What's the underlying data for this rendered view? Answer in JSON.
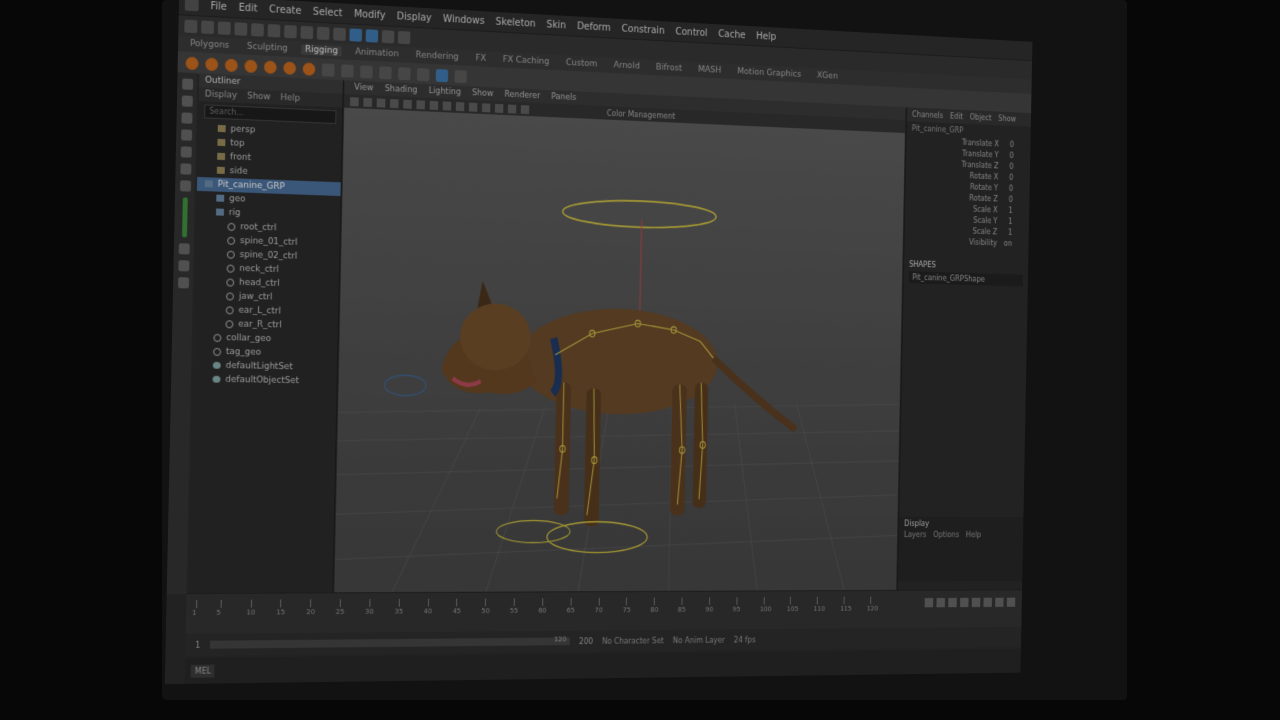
{
  "menubar": {
    "items": [
      "File",
      "Edit",
      "Create",
      "Select",
      "Modify",
      "Display",
      "Windows",
      "Skeleton",
      "Skin",
      "Deform",
      "Constrain",
      "Control",
      "Cache",
      "Help"
    ]
  },
  "shelf": {
    "tabs": [
      "Polygons",
      "Sculpting",
      "Rigging",
      "Animation",
      "Rendering",
      "FX",
      "FX Caching",
      "Custom",
      "Arnold",
      "Bifrost",
      "MASH",
      "Motion Graphics",
      "XGen"
    ],
    "active_tab": "Rigging"
  },
  "outliner": {
    "title": "Outliner",
    "menu": [
      "Display",
      "Show",
      "Help"
    ],
    "search_placeholder": "Search...",
    "rows": [
      {
        "label": "persp",
        "icon": "camera-icon",
        "indent": 1,
        "selected": false
      },
      {
        "label": "top",
        "icon": "camera-icon",
        "indent": 1,
        "selected": false
      },
      {
        "label": "front",
        "icon": "camera-icon",
        "indent": 1,
        "selected": false
      },
      {
        "label": "side",
        "icon": "camera-icon",
        "indent": 1,
        "selected": false
      },
      {
        "label": "Pit_canine_GRP",
        "icon": "group-icon",
        "indent": 0,
        "selected": true
      },
      {
        "label": "geo",
        "icon": "group-icon",
        "indent": 1,
        "selected": false
      },
      {
        "label": "rig",
        "icon": "group-icon",
        "indent": 1,
        "selected": false
      },
      {
        "label": "root_ctrl",
        "icon": "control-icon",
        "indent": 2,
        "selected": false
      },
      {
        "label": "spine_01_ctrl",
        "icon": "control-icon",
        "indent": 2,
        "selected": false
      },
      {
        "label": "spine_02_ctrl",
        "icon": "control-icon",
        "indent": 2,
        "selected": false
      },
      {
        "label": "neck_ctrl",
        "icon": "control-icon",
        "indent": 2,
        "selected": false
      },
      {
        "label": "head_ctrl",
        "icon": "control-icon",
        "indent": 2,
        "selected": false
      },
      {
        "label": "jaw_ctrl",
        "icon": "control-icon",
        "indent": 2,
        "selected": false
      },
      {
        "label": "ear_L_ctrl",
        "icon": "control-icon",
        "indent": 2,
        "selected": false
      },
      {
        "label": "ear_R_ctrl",
        "icon": "control-icon",
        "indent": 2,
        "selected": false
      },
      {
        "label": "collar_geo",
        "icon": "control-icon",
        "indent": 1,
        "selected": false
      },
      {
        "label": "tag_geo",
        "icon": "control-icon",
        "indent": 1,
        "selected": false
      },
      {
        "label": "defaultLightSet",
        "icon": "set-icon",
        "indent": 1,
        "selected": false
      },
      {
        "label": "defaultObjectSet",
        "icon": "set-icon",
        "indent": 1,
        "selected": false
      }
    ]
  },
  "viewport": {
    "menu": [
      "View",
      "Shading",
      "Lighting",
      "Show",
      "Renderer",
      "Panels"
    ],
    "camera_label": "Color Management"
  },
  "channel_box": {
    "menu": [
      "Channels",
      "Edit",
      "Object",
      "Show"
    ],
    "object_name": "Pit_canine_GRP",
    "attributes": [
      {
        "name": "Translate X",
        "value": "0"
      },
      {
        "name": "Translate Y",
        "value": "0"
      },
      {
        "name": "Translate Z",
        "value": "0"
      },
      {
        "name": "Rotate X",
        "value": "0"
      },
      {
        "name": "Rotate Y",
        "value": "0"
      },
      {
        "name": "Rotate Z",
        "value": "0"
      },
      {
        "name": "Scale X",
        "value": "1"
      },
      {
        "name": "Scale Y",
        "value": "1"
      },
      {
        "name": "Scale Z",
        "value": "1"
      },
      {
        "name": "Visibility",
        "value": "on"
      }
    ],
    "shapes_header": "SHAPES",
    "shape_name": "Pit_canine_GRPShape",
    "layers_title": "Display",
    "layers_menu": [
      "Layers",
      "Options",
      "Help"
    ]
  },
  "timeline": {
    "ticks": [
      1,
      5,
      10,
      15,
      20,
      25,
      30,
      35,
      40,
      45,
      50,
      55,
      60,
      65,
      70,
      75,
      80,
      85,
      90,
      95,
      100,
      105,
      110,
      115,
      120
    ],
    "current_frame": "1",
    "range_end": "120",
    "range_max": "200",
    "character_set": "No Character Set",
    "anim_layer": "No Anim Layer",
    "fps": "24 fps"
  },
  "command_line": {
    "language": "MEL"
  }
}
